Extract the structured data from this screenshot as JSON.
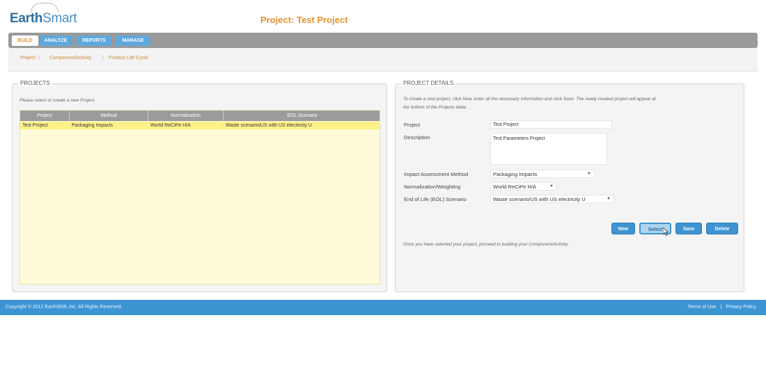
{
  "app": {
    "logo_bold": "Earth",
    "logo_light": "Smart",
    "project_title": "Project: Test Project"
  },
  "tabs": [
    {
      "label": "BUILD",
      "active": true
    },
    {
      "label": "ANALYZE",
      "active": false
    },
    {
      "label": "REPORTS",
      "active": false
    },
    {
      "label": "MANAGE",
      "active": false
    }
  ],
  "breadcrumb": {
    "items": [
      "Project",
      "Component/Activity",
      "Product Life Cycle"
    ],
    "separator": "|"
  },
  "projects_panel": {
    "legend": "PROJECTS",
    "hint": "Please select or create a new Project.",
    "columns": [
      "Project",
      "Method",
      "Normalization",
      "EOL Scenario"
    ],
    "rows": [
      {
        "project": "Test Project",
        "method": "Packaging Impacts",
        "normalization": "World ReCiPe H/A",
        "eol": "Waste scenario/US with US electricity U"
      }
    ]
  },
  "details_panel": {
    "legend": "PROJECT DETAILS",
    "hint_line1": "To create a new project, click New, enter all the necessary information and click Save. The newly created project will appear at",
    "hint_line2": "the bottom of the Projects table.",
    "project_label": "Project",
    "project_value": "Test Project",
    "description_label": "Description",
    "description_value": "Test Parameters Project",
    "impact_label": "Impact Assessment Method",
    "impact_value": "Packaging Impacts",
    "normalization_label": "Normalization/Weighting",
    "normalization_value": "World ReCiPe H/A",
    "eol_label": "End of Life (EOL) Scenario",
    "eol_value": "Waste scenario/US with US electricity U",
    "buttons": {
      "new": "New",
      "select": "Select",
      "save": "Save",
      "delete": "Delete"
    },
    "after_hint": "Once you have selected your project, proceed to building your Component/Activity."
  },
  "footer": {
    "copyright": "Copyright © 2012 EarthShift, Inc. All Rights Reserved.",
    "terms": "Terms of Use",
    "separator": "|",
    "privacy": "Privacy Policy"
  },
  "colors": {
    "accent_orange": "#e4932d",
    "brand_blue": "#3d94d3",
    "tab_blue": "#5fa8dc",
    "selected_row": "#fff18a",
    "table_bg": "#fffbd9"
  },
  "icons": {
    "dropdown": "chevron-down-icon",
    "cursor": "mouse-pointer-icon"
  }
}
